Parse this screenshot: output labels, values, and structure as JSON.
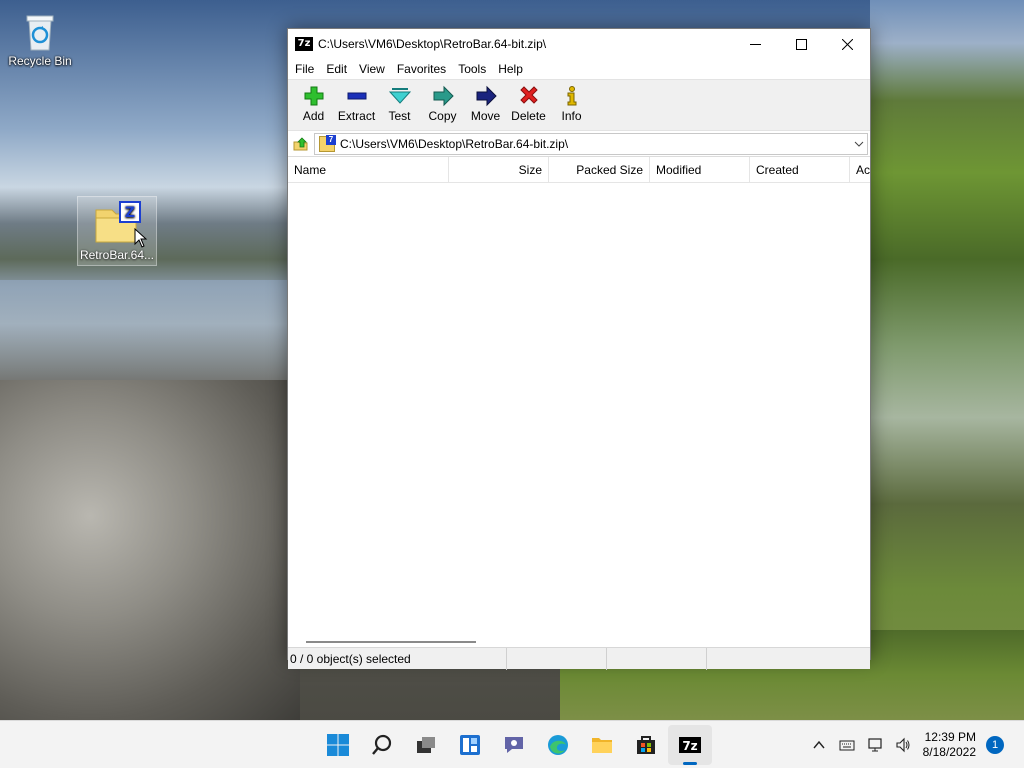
{
  "desktop": {
    "icons": [
      {
        "label": "Recycle Bin"
      },
      {
        "label": "RetroBar.64..."
      }
    ]
  },
  "window": {
    "title": "C:\\Users\\VM6\\Desktop\\RetroBar.64-bit.zip\\",
    "app_icon_text": "7z",
    "menu": [
      "File",
      "Edit",
      "View",
      "Favorites",
      "Tools",
      "Help"
    ],
    "toolbar": [
      {
        "label": "Add",
        "icon": "add-icon",
        "color": "#1fa51f"
      },
      {
        "label": "Extract",
        "icon": "extract-icon",
        "color": "#1a2fb8"
      },
      {
        "label": "Test",
        "icon": "test-icon",
        "color": "#22b5b5"
      },
      {
        "label": "Copy",
        "icon": "copy-icon",
        "color": "#2a8a7a"
      },
      {
        "label": "Move",
        "icon": "move-icon",
        "color": "#1a237e"
      },
      {
        "label": "Delete",
        "icon": "delete-icon",
        "color": "#d11a1a"
      },
      {
        "label": "Info",
        "icon": "info-icon",
        "color": "#d8b400"
      }
    ],
    "address": "C:\\Users\\VM6\\Desktop\\RetroBar.64-bit.zip\\",
    "columns": [
      "Name",
      "Size",
      "Packed Size",
      "Modified",
      "Created",
      "Ac"
    ],
    "status": "0 / 0 object(s) selected"
  },
  "taskbar": {
    "apps": [
      "start-icon",
      "search-icon",
      "task-view-icon",
      "widgets-icon",
      "chat-icon",
      "edge-icon",
      "file-explorer-icon",
      "store-icon",
      "7zip-icon"
    ],
    "app_7z_text": "7z",
    "time": "12:39 PM",
    "date": "8/18/2022",
    "notifications": "1"
  },
  "colors": {
    "accent": "#0067c0"
  }
}
